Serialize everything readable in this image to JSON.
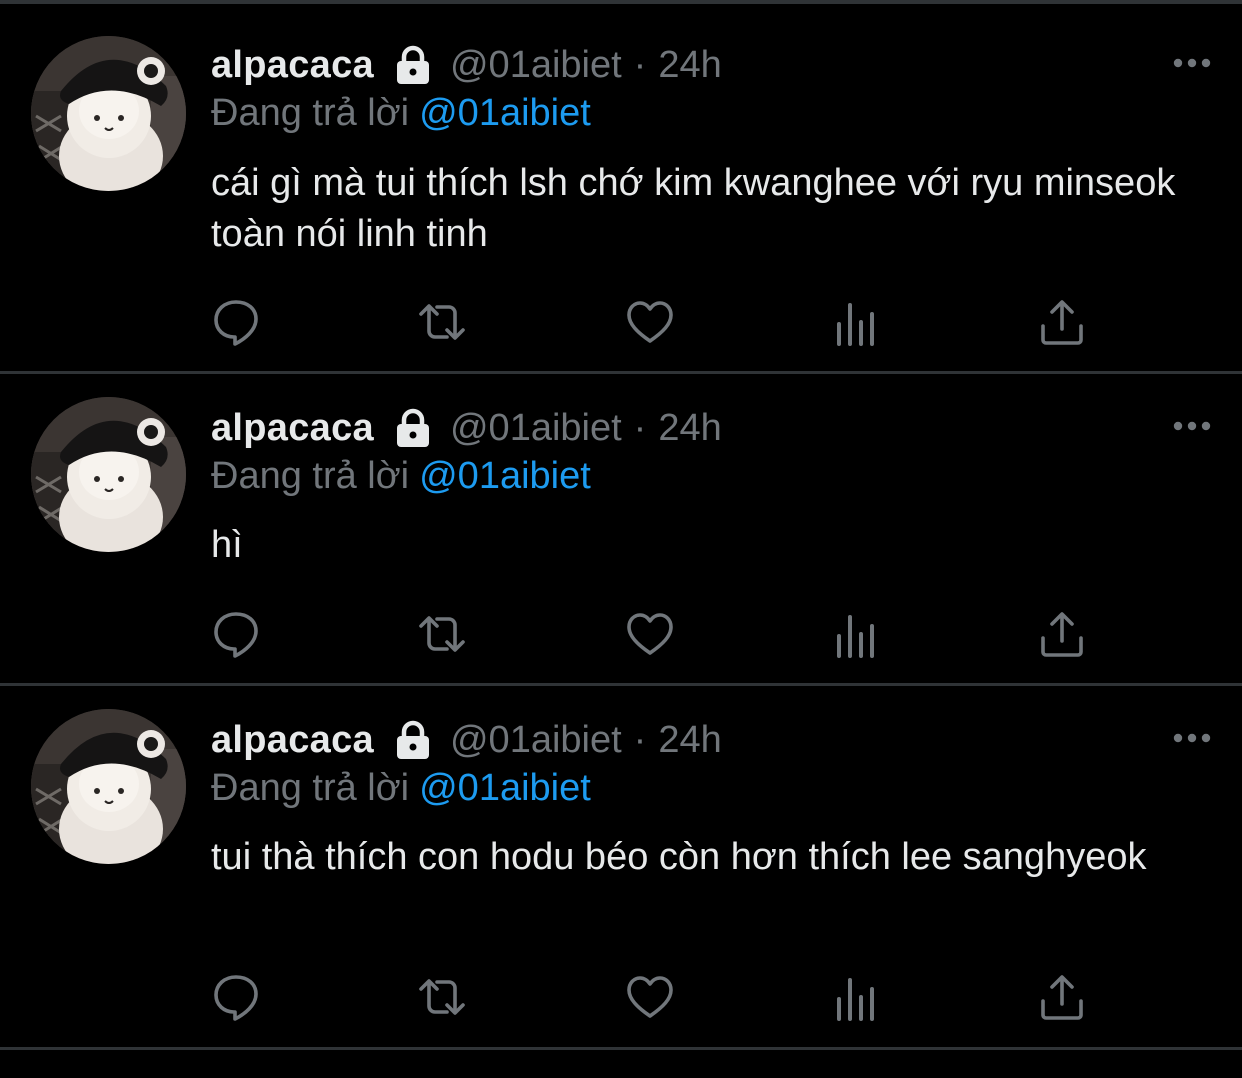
{
  "tweets": [
    {
      "name": "alpacaca",
      "handle": "@01aibiet",
      "separator": "·",
      "time": "24h",
      "reply_prefix": "Đang trả lời",
      "reply_target": "@01aibiet",
      "text": "cái gì mà tui thích lsh chớ kim kwanghee với ryu minseok toàn nói linh tinh"
    },
    {
      "name": "alpacaca",
      "handle": "@01aibiet",
      "separator": "·",
      "time": "24h",
      "reply_prefix": "Đang trả lời",
      "reply_target": "@01aibiet",
      "text": "hì"
    },
    {
      "name": "alpacaca",
      "handle": "@01aibiet",
      "separator": "·",
      "time": "24h",
      "reply_prefix": "Đang trả lời",
      "reply_target": "@01aibiet",
      "text": "tui thà thích con hodu béo còn hơn thích lee sanghyeok"
    }
  ],
  "icons": {
    "lock": "lock-icon",
    "more": "more-icon",
    "reply": "reply-icon",
    "retweet": "retweet-icon",
    "like": "heart-icon",
    "views": "views-icon",
    "share": "share-icon"
  },
  "colors": {
    "background": "#000000",
    "text": "#e7e9ea",
    "secondary": "#71767b",
    "accent": "#1d9bf0",
    "divider": "#2f3336"
  }
}
